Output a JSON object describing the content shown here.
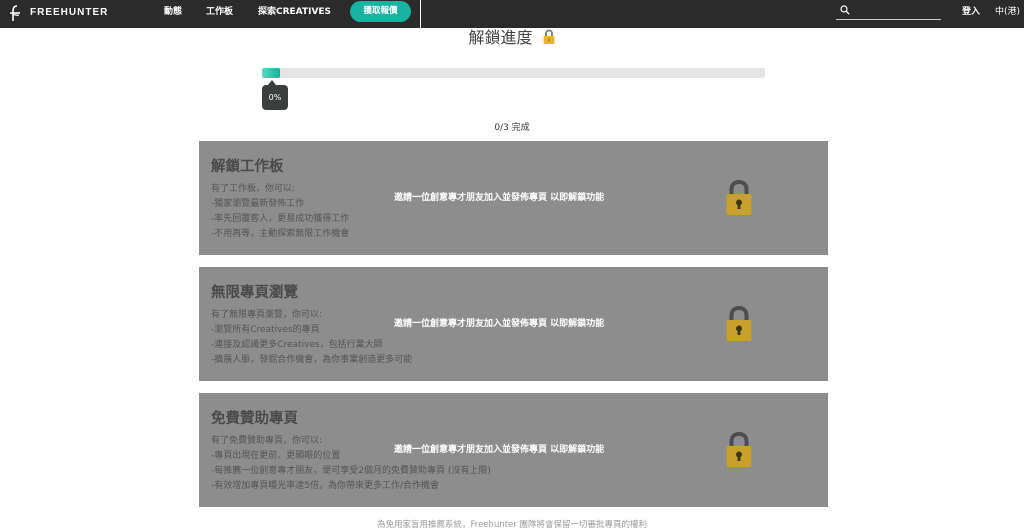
{
  "nav": {
    "brand": "FREEHUNTER",
    "links": [
      "動態",
      "工作板",
      "探索CREATIVES"
    ],
    "cta_label": "獲取報價",
    "search_placeholder": "",
    "login_label": "登入",
    "language_label": "中(港)"
  },
  "unlock": {
    "title": "解鎖進度",
    "progress_fraction": 0.035,
    "progress_label": "0%",
    "completion_text": "0/3  完成"
  },
  "cards": [
    {
      "title": "解鎖工作板",
      "lines": [
        "有了工作板，你可以:",
        "-獨家瀏覽最新發佈工作",
        "-率先回覆客人，更易成功獲得工作",
        "-不用再等，主動探索無限工作機會"
      ],
      "invite": "邀請一位創意專才朋友加入並發佈專頁 以即解鎖功能"
    },
    {
      "title": "無限專頁瀏覽",
      "lines": [
        "有了無限專頁瀏覽，你可以:",
        "-瀏覽所有Creatives的專頁",
        "-連接及認識更多Creatives，包括行業大師",
        "-擴展人脈，發掘合作機會，為你事業創造更多可能"
      ],
      "invite": "邀請一位創意專才朋友加入並發佈專頁 以即解鎖功能"
    },
    {
      "title": "免費贊助專頁",
      "lines": [
        "有了免費贊助專頁，你可以:",
        "-專頁出現在更前、更顯眼的位置",
        "-每推薦一位創意專才朋友，便可享受2個月的免費贊助專頁 (沒有上限)",
        "-有效增加專頁曝光率達5倍，為你帶來更多工作/合作機會"
      ],
      "invite": "邀請一位創意專才朋友加入並發佈專頁 以即解鎖功能"
    }
  ],
  "footer": {
    "note": "為免用家盲用推薦系統，Freehunter 團隊將會保留一切審批專頁的權利"
  },
  "colors": {
    "navbar": "#2b2b2b",
    "accent": "#19b3a2",
    "card_overlay": "#8d8d8d",
    "lock_gold": "#c8a02c"
  },
  "icons": {
    "logo": "freehunter-logo-icon",
    "search": "search-icon",
    "title_lock": "padlock-icon",
    "card_lock": "lock-icon"
  }
}
